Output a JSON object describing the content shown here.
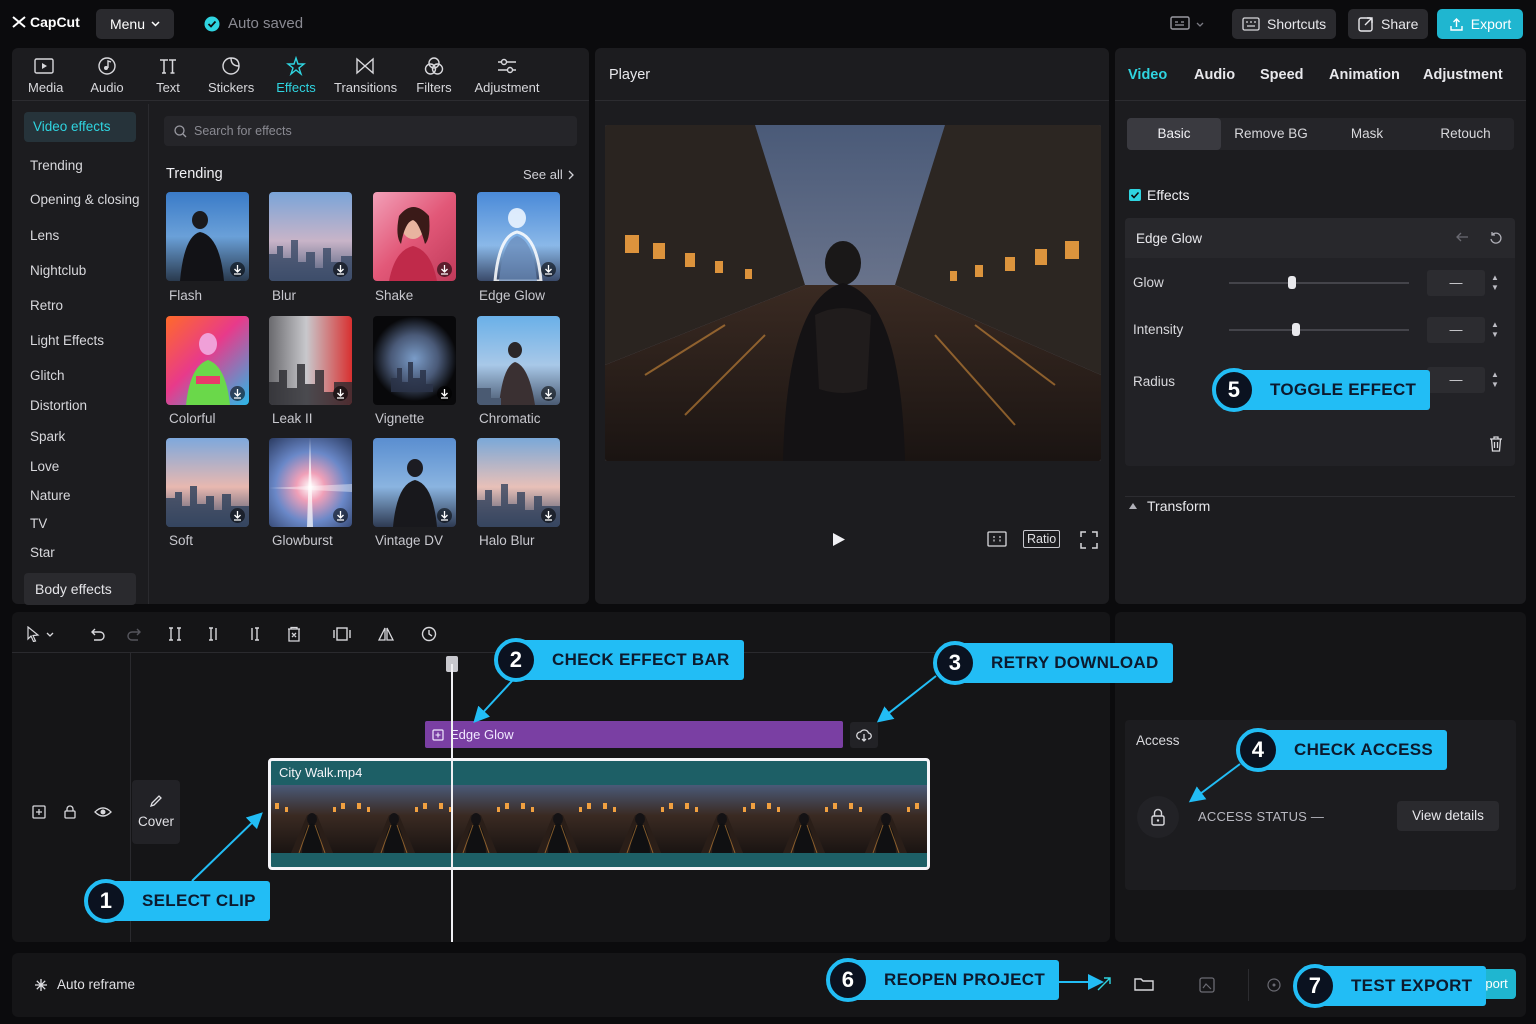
{
  "app": {
    "name": "CapCut",
    "menu_label": "Menu",
    "status": "Auto saved"
  },
  "topbar": {
    "shortcuts": "Shortcuts",
    "share": "Share",
    "export": "Export"
  },
  "tools": [
    {
      "label": "Media",
      "icon": "media-icon"
    },
    {
      "label": "Audio",
      "icon": "audio-icon"
    },
    {
      "label": "Text",
      "icon": "text-icon"
    },
    {
      "label": "Stickers",
      "icon": "stickers-icon"
    },
    {
      "label": "Effects",
      "icon": "effects-icon",
      "active": true
    },
    {
      "label": "Transitions",
      "icon": "transitions-icon"
    },
    {
      "label": "Filters",
      "icon": "filters-icon"
    },
    {
      "label": "Adjustment",
      "icon": "adjustment-icon"
    }
  ],
  "categories": {
    "active": "Video effects",
    "items": [
      "Trending",
      "Opening & closing",
      "Lens",
      "Nightclub",
      "Retro",
      "Light Effects",
      "Glitch",
      "Distortion",
      "Spark",
      "Love",
      "Nature",
      "TV",
      "Star"
    ],
    "body": "Body effects"
  },
  "effects_grid": {
    "search_placeholder": "Search for effects",
    "section_title": "Trending",
    "see_all": "See all",
    "items": [
      "Flash",
      "Blur",
      "Shake",
      "Edge Glow",
      "Colorful",
      "Leak II",
      "Vignette",
      "Chromatic",
      "Soft",
      "Glowburst",
      "Vintage DV",
      "Halo Blur"
    ]
  },
  "player": {
    "title": "Player",
    "ratio": "Ratio"
  },
  "inspector": {
    "tabs": [
      "Video",
      "Audio",
      "Speed",
      "Animation",
      "Adjustment"
    ],
    "subtabs": [
      "Basic",
      "Remove BG",
      "Mask",
      "Retouch"
    ],
    "effects_label": "Effects",
    "effect_name": "Edge Glow",
    "params": [
      {
        "label": "Glow",
        "value": "—",
        "level": 0.35
      },
      {
        "label": "Intensity",
        "value": "—",
        "level": 0.37
      },
      {
        "label": "Radius",
        "value": "—"
      }
    ],
    "transform": "Transform"
  },
  "timeline": {
    "effect_bar": "Edge Glow",
    "clip_name": "City Walk.mp4",
    "cover": "Cover"
  },
  "access": {
    "label": "Access",
    "status": "ACCESS STATUS —",
    "view_details": "View details"
  },
  "bottombar": {
    "auto_reframe": "Auto reframe",
    "export": "Export"
  },
  "callouts": [
    {
      "num": "1",
      "text": "SELECT CLIP"
    },
    {
      "num": "2",
      "text": "CHECK EFFECT BAR"
    },
    {
      "num": "3",
      "text": "RETRY DOWNLOAD"
    },
    {
      "num": "4",
      "text": "CHECK ACCESS"
    },
    {
      "num": "5",
      "text": "TOGGLE EFFECT"
    },
    {
      "num": "6",
      "text": "REOPEN PROJECT"
    },
    {
      "num": "7",
      "text": "TEST EXPORT"
    }
  ],
  "colors": {
    "accent": "#2fd4e0",
    "callout": "#22bdf5",
    "effect_bar": "#7a3fa3",
    "export": "#1fb6d0"
  }
}
